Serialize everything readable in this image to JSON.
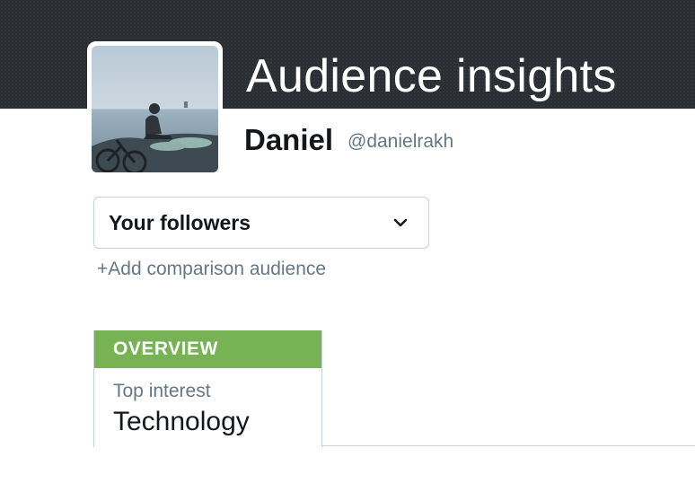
{
  "header": {
    "title": "Audience insights"
  },
  "user": {
    "name": "Daniel",
    "handle": "@danielrakh",
    "avatar_icon": "profile-photo"
  },
  "audience_select": {
    "value": "Your followers",
    "icon": "chevron-down-icon"
  },
  "add_comparison": {
    "label": "+Add comparison audience"
  },
  "overview": {
    "tab_label": "OVERVIEW",
    "top_interest_label": "Top interest",
    "top_interest_value": "Technology"
  },
  "colors": {
    "header_bg": "#2b2f35",
    "overview_green": "#77b255",
    "muted_text": "#657786",
    "border": "#c6d2da"
  }
}
